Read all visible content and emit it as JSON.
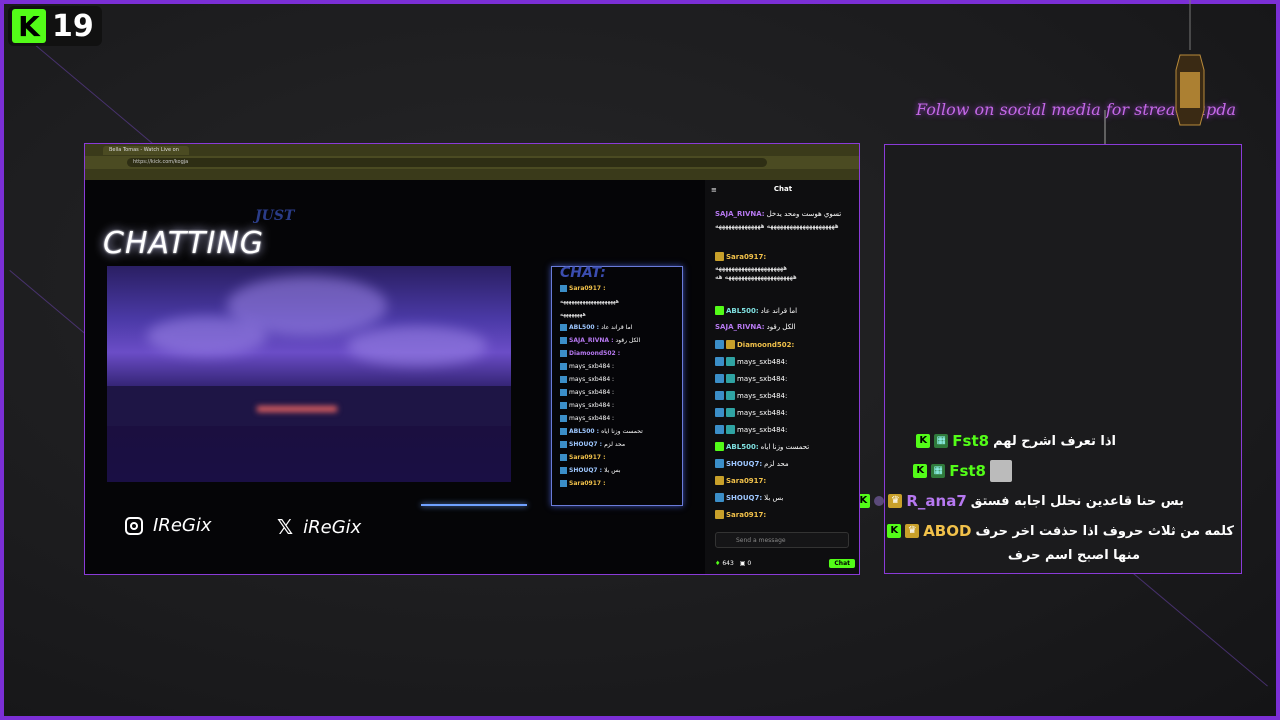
{
  "badge": {
    "logo": "K",
    "number": "19"
  },
  "follow_text": "Follow on social media for stream upda",
  "right_chat": [
    {
      "user": "Fst8",
      "text": "اذا تعرف اشرح لهم",
      "name_color": "green"
    },
    {
      "user": "Fst8",
      "text": "",
      "name_color": "green",
      "avatar": true
    },
    {
      "user": "R_ana7",
      "text": "بس حنا قاعدين نحلل اجابه فستق",
      "name_color": "purple"
    },
    {
      "user": "ABOD",
      "text": "كلمه من ثلاث حروف اذا حذفت اخر حرف",
      "name_color": "gold"
    }
  ],
  "right_chat_continuation": "منها اصبح اسم حرف",
  "browser": {
    "tab_title": "Bella Tomas - Watch Live on Kick",
    "url": "https://kick.com/kogja"
  },
  "stage": {
    "just": "JUST",
    "title": "CHATTING",
    "instagram": "IReGix",
    "x_handle": "iReGix",
    "mini_chat_title": "CHAT:"
  },
  "mini_chat": [
    {
      "user": "Sara0917 :",
      "text": "",
      "cls": "g"
    },
    {
      "user": "",
      "text": "ههههههههههههههههههههه",
      "cls": ""
    },
    {
      "user": "",
      "text": "ههههههههه",
      "cls": ""
    },
    {
      "user": "ABL500 :",
      "text": "اما قراند عاد",
      "cls": "b"
    },
    {
      "user": "SAJA_RIVNA :",
      "text": "الكل رقود",
      "cls": "p"
    },
    {
      "user": "Diamoond502 :",
      "text": "",
      "cls": "p"
    },
    {
      "user": "mays_sxb484 :",
      "text": "",
      "cls": ""
    },
    {
      "user": "mays_sxb484 :",
      "text": "",
      "cls": ""
    },
    {
      "user": "mays_sxb484 :",
      "text": "",
      "cls": ""
    },
    {
      "user": "mays_sxb484 :",
      "text": "",
      "cls": ""
    },
    {
      "user": "mays_sxb484 :",
      "text": "",
      "cls": ""
    },
    {
      "user": "ABL500 :",
      "text": "تحمست وزنا اياه",
      "cls": "b"
    },
    {
      "user": "SHOUQ7 :",
      "text": "محد لزم",
      "cls": "b"
    },
    {
      "user": "Sara0917 :",
      "text": "",
      "cls": "g"
    },
    {
      "user": "SHOUQ7 :",
      "text": "بس بلا",
      "cls": "b"
    },
    {
      "user": "Sara0917 :",
      "text": "",
      "cls": "g"
    }
  ],
  "kick_chat": {
    "header": "Chat",
    "input_placeholder": "Send a message",
    "viewers": "643",
    "gifts": "0",
    "send": "Chat"
  }
}
